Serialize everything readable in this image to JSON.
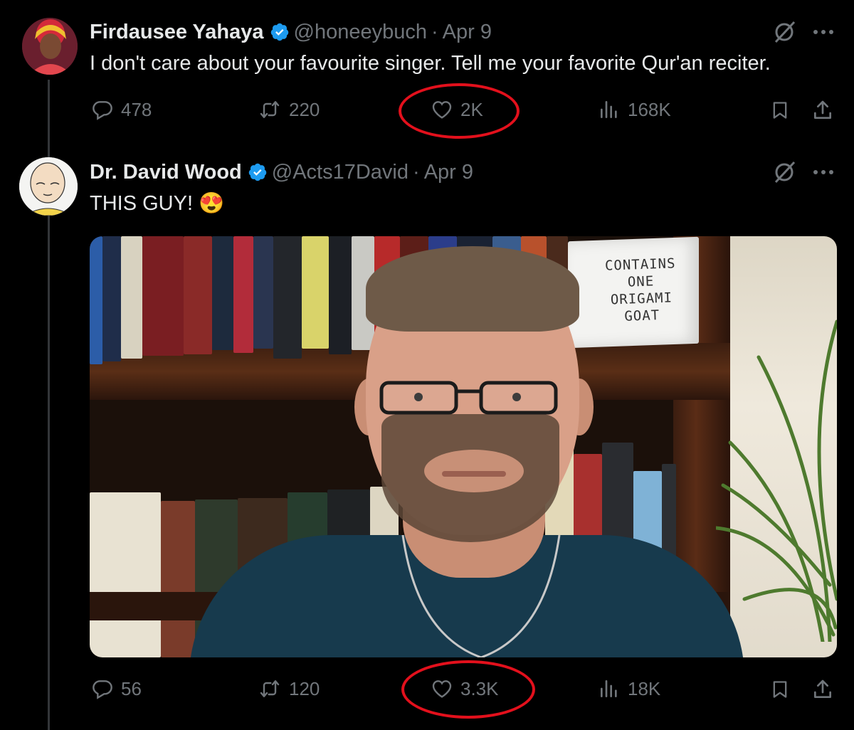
{
  "thread": [
    {
      "author": {
        "name": "Firdausee Yahaya",
        "handle": "@honeeybuch",
        "date": "Apr 9",
        "verified": true
      },
      "text": "I don't care about your favourite singer. Tell me your favorite Qur'an reciter.",
      "stats": {
        "replies": "478",
        "reposts": "220",
        "likes": "2K",
        "views": "168K"
      }
    },
    {
      "author": {
        "name": "Dr. David Wood",
        "handle": "@Acts17David",
        "date": "Apr 9",
        "verified": true
      },
      "text": "THIS GUY! 😍",
      "media": {
        "box_label": [
          "CONTAINS",
          "ONE",
          "ORIGAMI",
          "GOAT"
        ]
      },
      "stats": {
        "replies": "56",
        "reposts": "120",
        "likes": "3.3K",
        "views": "18K"
      }
    }
  ],
  "separator": "·",
  "colors": {
    "background": "#000000",
    "text": "#e7e9ea",
    "muted": "#71767b",
    "verified": "#1d9bf0",
    "highlight_circle": "#e3101c"
  },
  "icons": {
    "reply": "speech-bubble-icon",
    "repost": "repost-arrows-icon",
    "like": "heart-icon",
    "views": "bar-chart-icon",
    "bookmark": "bookmark-icon",
    "share": "share-upload-icon",
    "grok": "slashed-circle-icon",
    "more": "more-dots-icon",
    "verified": "verified-badge-icon"
  }
}
